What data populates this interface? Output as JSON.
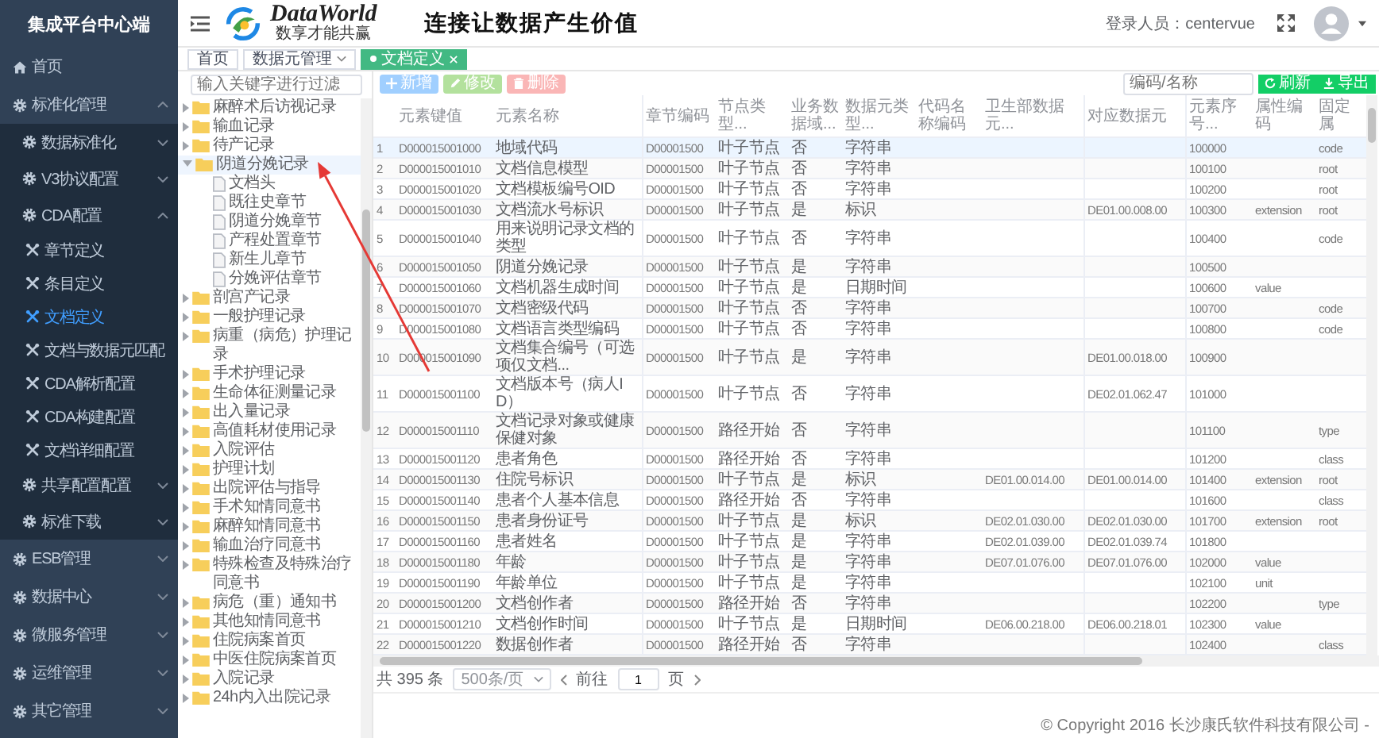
{
  "sidebar": {
    "title": "集成平台中心端",
    "items": [
      {
        "label": "首页",
        "kind": "home",
        "selected": false
      },
      {
        "label": "标准化管理",
        "kind": "gear",
        "expanded": true,
        "selected": false,
        "children": [
          {
            "label": "数据标准化",
            "kind": "gear",
            "expanded": false,
            "selected": false
          },
          {
            "label": "V3协议配置",
            "kind": "gear",
            "expanded": false,
            "selected": false
          },
          {
            "label": "CDA配置",
            "kind": "gear",
            "expanded": true,
            "selected": false,
            "children": [
              {
                "label": "章节定义",
                "kind": "tool",
                "selected": false
              },
              {
                "label": "条目定义",
                "kind": "tool",
                "selected": false
              },
              {
                "label": "文档定义",
                "kind": "tool",
                "selected": true
              },
              {
                "label": "文档与数据元匹配",
                "kind": "tool",
                "selected": false
              },
              {
                "label": "CDA解析配置",
                "kind": "tool",
                "selected": false
              },
              {
                "label": "CDA构建配置",
                "kind": "tool",
                "selected": false
              },
              {
                "label": "文档详细配置",
                "kind": "tool",
                "selected": false
              }
            ]
          },
          {
            "label": "共享配置配置",
            "kind": "gear",
            "expanded": false,
            "selected": false
          },
          {
            "label": "标准下载",
            "kind": "gear",
            "expanded": false,
            "selected": false
          }
        ]
      },
      {
        "label": "ESB管理",
        "kind": "gear",
        "expanded": false,
        "selected": false
      },
      {
        "label": "数据中心",
        "kind": "gear",
        "expanded": false,
        "selected": false
      },
      {
        "label": "微服务管理",
        "kind": "gear",
        "expanded": false,
        "selected": false
      },
      {
        "label": "运维管理",
        "kind": "gear",
        "expanded": false,
        "selected": false
      },
      {
        "label": "其它管理",
        "kind": "gear",
        "expanded": false,
        "selected": false
      }
    ]
  },
  "header": {
    "brand": "DataWorld",
    "brand_subtitle": "数享才能共赢",
    "slogan": "连接让数据产生价值",
    "user_label": "登录人员：centervue"
  },
  "tabs": [
    {
      "label": "首页",
      "kind": "plain",
      "selected": false
    },
    {
      "label": "数据元管理",
      "kind": "dropdown",
      "selected": false
    },
    {
      "label": "文档定义",
      "kind": "closable",
      "selected": true
    }
  ],
  "tree": {
    "search_placeholder": "输入关键字进行过滤",
    "items": [
      {
        "label": "麻醉术后访视记录",
        "kind": "folder",
        "expanded": false,
        "selected": false
      },
      {
        "label": "输血记录",
        "kind": "folder",
        "expanded": false,
        "selected": false
      },
      {
        "label": "待产记录",
        "kind": "folder",
        "expanded": false,
        "selected": false
      },
      {
        "label": "阴道分娩记录",
        "kind": "folder",
        "expanded": true,
        "selected": true,
        "children": [
          {
            "label": "文档头",
            "kind": "document",
            "selected": false
          },
          {
            "label": "既往史章节",
            "kind": "document",
            "selected": false
          },
          {
            "label": "阴道分娩章节",
            "kind": "document",
            "selected": false
          },
          {
            "label": "产程处置章节",
            "kind": "document",
            "selected": false
          },
          {
            "label": "新生儿章节",
            "kind": "document",
            "selected": false
          },
          {
            "label": "分娩评估章节",
            "kind": "document",
            "selected": false
          }
        ]
      },
      {
        "label": "剖宫产记录",
        "kind": "folder",
        "expanded": false,
        "selected": false
      },
      {
        "label": "一般护理记录",
        "kind": "folder",
        "expanded": false,
        "selected": false
      },
      {
        "label": "病重（病危）护理记录",
        "kind": "folder",
        "expanded": false,
        "selected": false
      },
      {
        "label": "手术护理记录",
        "kind": "folder",
        "expanded": false,
        "selected": false
      },
      {
        "label": "生命体征测量记录",
        "kind": "folder",
        "expanded": false,
        "selected": false
      },
      {
        "label": "出入量记录",
        "kind": "folder",
        "expanded": false,
        "selected": false
      },
      {
        "label": "高值耗材使用记录",
        "kind": "folder",
        "expanded": false,
        "selected": false
      },
      {
        "label": "入院评估",
        "kind": "folder",
        "expanded": false,
        "selected": false
      },
      {
        "label": "护理计划",
        "kind": "folder",
        "expanded": false,
        "selected": false
      },
      {
        "label": "出院评估与指导",
        "kind": "folder",
        "expanded": false,
        "selected": false
      },
      {
        "label": "手术知情同意书",
        "kind": "folder",
        "expanded": false,
        "selected": false
      },
      {
        "label": "麻醉知情同意书",
        "kind": "folder",
        "expanded": false,
        "selected": false
      },
      {
        "label": "输血治疗同意书",
        "kind": "folder",
        "expanded": false,
        "selected": false
      },
      {
        "label": "特殊检查及特殊治疗同意书",
        "kind": "folder",
        "expanded": false,
        "selected": false
      },
      {
        "label": "病危（重）通知书",
        "kind": "folder",
        "expanded": false,
        "selected": false
      },
      {
        "label": "其他知情同意书",
        "kind": "folder",
        "expanded": false,
        "selected": false
      },
      {
        "label": "住院病案首页",
        "kind": "folder",
        "expanded": false,
        "selected": false
      },
      {
        "label": "中医住院病案首页",
        "kind": "folder",
        "expanded": false,
        "selected": false
      },
      {
        "label": "入院记录",
        "kind": "folder",
        "expanded": false,
        "selected": false
      },
      {
        "label": "24h内入出院记录",
        "kind": "folder",
        "expanded": false,
        "selected": false
      }
    ]
  },
  "toolbar": {
    "buttons": [
      {
        "label": "新增",
        "kind": "add"
      },
      {
        "label": "修改",
        "kind": "edit"
      },
      {
        "label": "删除",
        "kind": "delete"
      }
    ],
    "search_placeholder": "编码/名称",
    "actions": [
      {
        "label": "刷新",
        "kind": "refresh"
      },
      {
        "label": "导出",
        "kind": "export"
      }
    ]
  },
  "table": {
    "columns": [
      "",
      "元素键值",
      "元素名称",
      "章节编码",
      "节点类型...",
      "业务数据域...",
      "数据元类型...",
      "代码名称编码",
      "卫生部数据元...",
      "对应数据元",
      "元素序号...",
      "属性编码",
      "固定属"
    ],
    "rows": [
      {
        "selected": true,
        "cells": [
          "1",
          "D000015001000",
          "地域代码",
          "D00001500",
          "叶子节点",
          "否",
          "字符串",
          null,
          null,
          null,
          "100000",
          null,
          "code"
        ]
      },
      {
        "selected": false,
        "cells": [
          "2",
          "D000015001010",
          "文档信息模型",
          "D00001500",
          "叶子节点",
          "否",
          "字符串",
          null,
          null,
          null,
          "100100",
          null,
          "root"
        ]
      },
      {
        "selected": false,
        "cells": [
          "3",
          "D000015001020",
          "文档模板编号OID",
          "D00001500",
          "叶子节点",
          "否",
          "字符串",
          null,
          null,
          null,
          "100200",
          null,
          "root"
        ]
      },
      {
        "selected": false,
        "cells": [
          "4",
          "D000015001030",
          "文档流水号标识",
          "D00001500",
          "叶子节点",
          "是",
          "标识",
          null,
          null,
          "DE01.00.008.00",
          "100300",
          "extension",
          "root"
        ]
      },
      {
        "selected": false,
        "cells": [
          "5",
          "D000015001040",
          "用来说明记录文档的类型",
          "D00001500",
          "叶子节点",
          "否",
          "字符串",
          null,
          null,
          null,
          "100400",
          null,
          "code"
        ]
      },
      {
        "selected": false,
        "cells": [
          "6",
          "D000015001050",
          "阴道分娩记录",
          "D00001500",
          "叶子节点",
          "是",
          "字符串",
          null,
          null,
          null,
          "100500",
          null,
          null
        ]
      },
      {
        "selected": false,
        "cells": [
          "7",
          "D000015001060",
          "文档机器生成时间",
          "D00001500",
          "叶子节点",
          "是",
          "日期时间",
          null,
          null,
          null,
          "100600",
          "value",
          null
        ]
      },
      {
        "selected": false,
        "cells": [
          "8",
          "D000015001070",
          "文档密级代码",
          "D00001500",
          "叶子节点",
          "否",
          "字符串",
          null,
          null,
          null,
          "100700",
          null,
          "code"
        ]
      },
      {
        "selected": false,
        "cells": [
          "9",
          "D000015001080",
          "文档语言类型编码",
          "D00001500",
          "叶子节点",
          "否",
          "字符串",
          null,
          null,
          null,
          "100800",
          null,
          "code"
        ]
      },
      {
        "selected": false,
        "cells": [
          "10",
          "D000015001090",
          "文档集合编号（可选项仅文档...",
          "D00001500",
          "叶子节点",
          "是",
          "字符串",
          null,
          null,
          "DE01.00.018.00",
          "100900",
          null,
          null
        ]
      },
      {
        "selected": false,
        "cells": [
          "11",
          "D000015001100",
          "文档版本号（病人ID）",
          "D00001500",
          "叶子节点",
          "否",
          "字符串",
          null,
          null,
          "DE02.01.062.47",
          "101000",
          null,
          null
        ]
      },
      {
        "selected": false,
        "cells": [
          "12",
          "D000015001110",
          "文档记录对象或健康保健对象",
          "D00001500",
          "路径开始",
          "否",
          "字符串",
          null,
          null,
          null,
          "101100",
          null,
          "type"
        ]
      },
      {
        "selected": false,
        "cells": [
          "13",
          "D000015001120",
          "患者角色",
          "D00001500",
          "路径开始",
          "否",
          "字符串",
          null,
          null,
          null,
          "101200",
          null,
          "class"
        ]
      },
      {
        "selected": false,
        "cells": [
          "14",
          "D000015001130",
          "住院号标识",
          "D00001500",
          "叶子节点",
          "是",
          "标识",
          null,
          "DE01.00.014.00",
          "DE01.00.014.00",
          "101400",
          "extension",
          "root"
        ]
      },
      {
        "selected": false,
        "cells": [
          "15",
          "D000015001140",
          "患者个人基本信息",
          "D00001500",
          "路径开始",
          "否",
          "字符串",
          null,
          null,
          null,
          "101600",
          null,
          "class"
        ]
      },
      {
        "selected": false,
        "cells": [
          "16",
          "D000015001150",
          "患者身份证号",
          "D00001500",
          "叶子节点",
          "是",
          "标识",
          null,
          "DE02.01.030.00",
          "DE02.01.030.00",
          "101700",
          "extension",
          "root"
        ]
      },
      {
        "selected": false,
        "cells": [
          "17",
          "D000015001160",
          "患者姓名",
          "D00001500",
          "叶子节点",
          "是",
          "字符串",
          null,
          "DE02.01.039.00",
          "DE02.01.039.74",
          "101800",
          null,
          null
        ]
      },
      {
        "selected": false,
        "cells": [
          "18",
          "D000015001180",
          "年龄",
          "D00001500",
          "叶子节点",
          "是",
          "字符串",
          null,
          "DE07.01.076.00",
          "DE07.01.076.00",
          "102000",
          "value",
          null
        ]
      },
      {
        "selected": false,
        "cells": [
          "19",
          "D000015001190",
          "年龄单位",
          "D00001500",
          "叶子节点",
          "是",
          "字符串",
          null,
          null,
          null,
          "102100",
          "unit",
          null
        ]
      },
      {
        "selected": false,
        "cells": [
          "20",
          "D000015001200",
          "文档创作者",
          "D00001500",
          "路径开始",
          "否",
          "字符串",
          null,
          null,
          null,
          "102200",
          null,
          "type"
        ]
      },
      {
        "selected": false,
        "cells": [
          "21",
          "D000015001210",
          "文档创作时间",
          "D00001500",
          "叶子节点",
          "是",
          "日期时间",
          null,
          "DE06.00.218.00",
          "DE06.00.218.01",
          "102300",
          "value",
          null
        ]
      },
      {
        "selected": false,
        "cells": [
          "22",
          "D000015001220",
          "数据创作者",
          "D00001500",
          "路径开始",
          "否",
          "字符串",
          null,
          null,
          null,
          "102400",
          null,
          "class"
        ]
      }
    ]
  },
  "pagination": {
    "total": "共 395 条",
    "page_size": "500条/页",
    "goto_label": "前往",
    "page": "1",
    "page_suffix": "页"
  },
  "footer": "© Copyright 2016 长沙康氏软件科技有限公司 -"
}
